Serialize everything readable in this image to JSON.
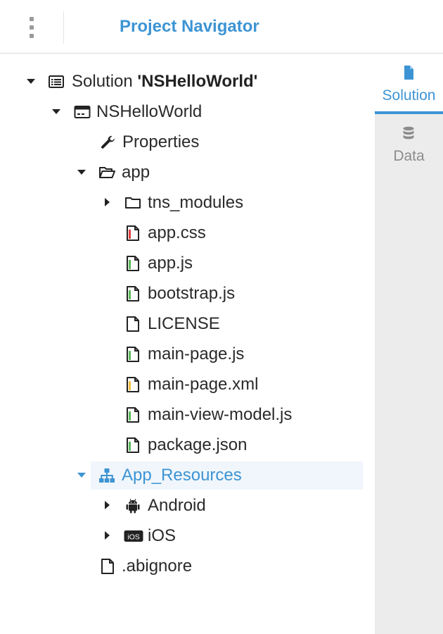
{
  "header": {
    "title": "Project Navigator",
    "menu_icon": "kebab-menu-icon"
  },
  "tree": {
    "solution": {
      "prefix": "Solution ",
      "name": "'NSHelloWorld'",
      "icon": "solution-list-icon",
      "expanded": true
    },
    "project": {
      "label": "NSHelloWorld",
      "icon": "project-window-icon",
      "expanded": true
    },
    "properties": {
      "label": "Properties",
      "icon": "wrench-icon"
    },
    "app": {
      "label": "app",
      "icon": "folder-open-icon",
      "expanded": true
    },
    "tns_modules": {
      "label": "tns_modules",
      "icon": "folder-icon",
      "expanded": false
    },
    "app_css": {
      "label": "app.css",
      "icon": "css-file-icon"
    },
    "app_js": {
      "label": "app.js",
      "icon": "js-file-icon"
    },
    "bootstrap_js": {
      "label": "bootstrap.js",
      "icon": "js-file-icon"
    },
    "license": {
      "label": "LICENSE",
      "icon": "file-icon"
    },
    "main_page_js": {
      "label": "main-page.js",
      "icon": "js-file-icon"
    },
    "main_page_xml": {
      "label": "main-page.xml",
      "icon": "xml-file-icon"
    },
    "main_view_model_js": {
      "label": "main-view-model.js",
      "icon": "js-file-icon"
    },
    "package_json": {
      "label": "package.json",
      "icon": "json-file-icon"
    },
    "app_resources": {
      "label": "App_Resources",
      "icon": "sitemap-icon",
      "expanded": true,
      "selected": true
    },
    "android": {
      "label": "Android",
      "icon": "android-icon",
      "expanded": false
    },
    "ios": {
      "label": "iOS",
      "icon": "ios-badge-icon",
      "badge": "iOS",
      "expanded": false
    },
    "abignore": {
      "label": ".abignore",
      "icon": "file-icon"
    }
  },
  "sidebar": {
    "tabs": [
      {
        "label": "Solution",
        "icon": "document-icon",
        "active": true
      },
      {
        "label": "Data",
        "icon": "database-icon",
        "active": false
      }
    ]
  },
  "colors": {
    "accent": "#3d94d4",
    "css_marker": "#e04040",
    "js_marker": "#5cb85c",
    "xml_marker": "#f0c040",
    "json_marker": "#5cb85c",
    "selected_row_bg": "#f0f6fb",
    "sidebar_bg": "#ececec"
  }
}
